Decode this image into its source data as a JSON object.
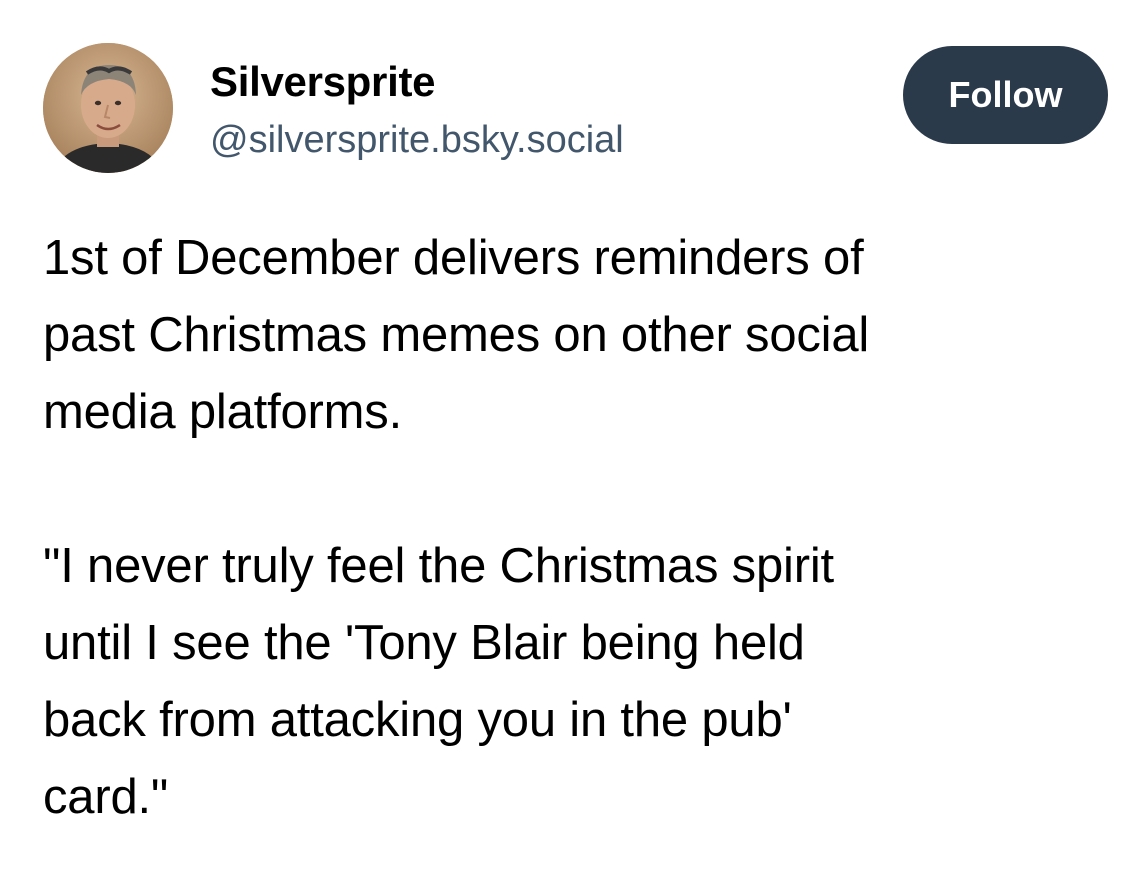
{
  "author": {
    "display_name": "Silversprite",
    "handle": "@silversprite.bsky.social",
    "avatar_icon": "user-avatar-photo"
  },
  "actions": {
    "follow_label": "Follow"
  },
  "post": {
    "paragraphs": [
      "1st of December delivers reminders of\npast Christmas memes on other social\nmedia platforms.",
      "\"I never truly feel the Christmas spirit\nuntil I see the 'Tony Blair being held\nback from attacking you in the pub'\ncard.\""
    ]
  },
  "colors": {
    "follow_button_bg": "#2b3a4b",
    "handle_text": "#42576c",
    "body_text": "#000000"
  }
}
